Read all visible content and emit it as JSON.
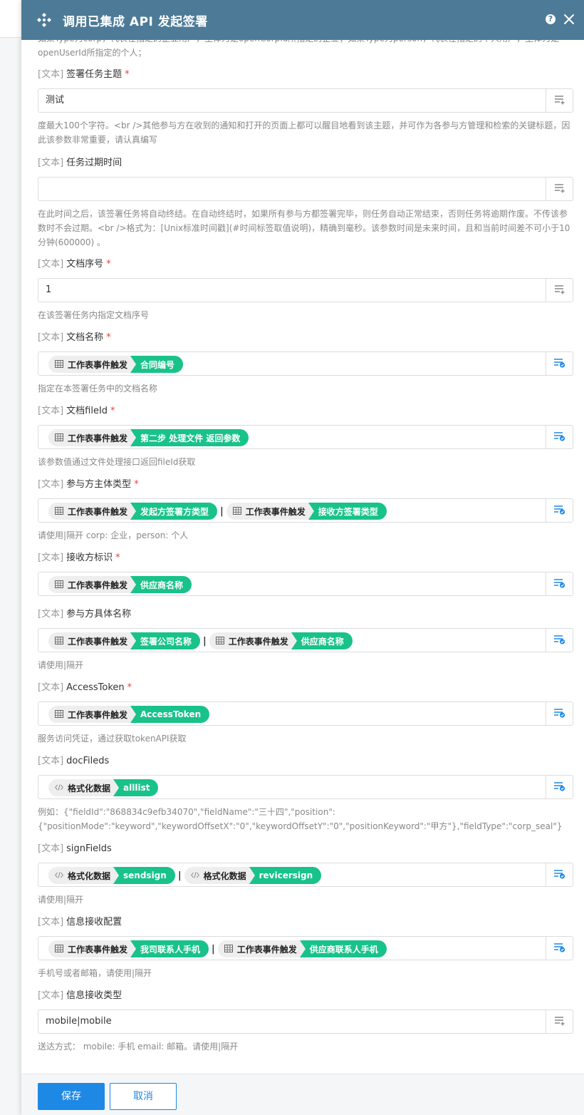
{
  "dialog": {
    "title": "调用已集成 API 发起签署",
    "help_label": "?"
  },
  "top_desc": "如果Type为corp，代表在指定的企业用户，主体为是openCorpId所指定的企业；如果Type为person，代表在指定的个人用户，主体为是openUserId所指定的个人；",
  "fields": [
    {
      "tag": "[文本]",
      "label": "签署任务主题",
      "required": "*",
      "value": "测试",
      "desc": "度最大100个字符。<br />其他参与方在收到的通知和打开的页面上都可以醒目地看到该主题，并可作为各参与方管理和检索的关键标题，因此该参数非常重要，请认真编写"
    },
    {
      "tag": "[文本]",
      "label": "任务过期时间",
      "value": "",
      "desc": "在此时间之后，该签署任务将自动终结。在自动终结时，如果所有参与方都签署完毕，则任务自动正常结束，否则任务将逾期作废。不传该参数时不会过期。<br />格式为：[Unix标准时间戳](#时间标签取值说明)，精确到毫秒。该参数时间是未来时间，且和当前时间差不可小于10分钟(600000) 。"
    },
    {
      "tag": "[文本]",
      "label": "文档序号",
      "required": "*",
      "value": "1",
      "desc": "在该签署任务内指定文档序号"
    },
    {
      "tag": "[文本]",
      "label": "文档名称",
      "required": "*",
      "chips": [
        {
          "source": "工作表事件触发",
          "value": "合同编号"
        }
      ],
      "desc": "指定在本签署任务中的文档名称"
    },
    {
      "tag": "[文本]",
      "label": "文档fileId",
      "required": "*",
      "chips": [
        {
          "source": "工作表事件触发",
          "value": "第二步 处理文件 返回参数"
        }
      ],
      "desc": "该参数值通过文件处理接口返回fileId获取"
    },
    {
      "tag": "[文本]",
      "label": "参与方主体类型",
      "required": "*",
      "chips": [
        {
          "source": "工作表事件触发",
          "value": "发起方签署方类型"
        },
        {
          "source": "工作表事件触发",
          "value": "接收方签署类型"
        }
      ],
      "separator": "|",
      "desc": "请使用|隔开 corp: 企业，person: 个人"
    },
    {
      "tag": "[文本]",
      "label": "接收方标识",
      "required": "*",
      "chips": [
        {
          "source": "工作表事件触发",
          "value": "供应商名称"
        }
      ]
    },
    {
      "tag": "[文本]",
      "label": "参与方具体名称",
      "chips": [
        {
          "source": "工作表事件触发",
          "value": "签署公司名称"
        },
        {
          "source": "工作表事件触发",
          "value": "供应商名称"
        }
      ],
      "separator": "|",
      "desc": "请使用|隔开"
    },
    {
      "tag": "[文本]",
      "label": "AccessToken",
      "required": "*",
      "chips": [
        {
          "source": "工作表事件触发",
          "value": "AccessToken"
        }
      ],
      "desc": "服务访问凭证，通过获取tokenAPI获取"
    },
    {
      "tag": "[文本]",
      "label": "docFileds",
      "chips": [
        {
          "source": "格式化数据",
          "value": "alllist"
        }
      ],
      "desc": "例如：{\"fieldId\":\"868834c9efb34070\",\"fieldName\":\"三十四\",\"position\":{\"positionMode\":\"keyword\",\"keywordOffsetX\":\"0\",\"keywordOffsetY\":\"0\",\"positionKeyword\":\"甲方\"},\"fieldType\":\"corp_seal\"}"
    },
    {
      "tag": "[文本]",
      "label": "signFields",
      "chips": [
        {
          "source": "格式化数据",
          "value": "sendsign"
        },
        {
          "source": "格式化数据",
          "value": "revicersign"
        }
      ],
      "separator": "|",
      "desc": "请使用|隔开"
    },
    {
      "tag": "[文本]",
      "label": "信息接收配置",
      "chips": [
        {
          "source": "工作表事件触发",
          "value": "我司联系人手机"
        },
        {
          "source": "工作表事件触发",
          "value": "供应商联系人手机"
        }
      ],
      "separator": "|",
      "desc": "手机号或者邮箱，请使用|隔开"
    },
    {
      "tag": "[文本]",
      "label": "信息接收类型",
      "value": "mobile|mobile",
      "desc": "送达方式： mobile: 手机 email: 邮箱。请使用|隔开"
    }
  ],
  "footer": {
    "save_label": "保存",
    "cancel_label": "取消"
  },
  "colors": {
    "header": "#4d7a97",
    "chip_value": "#19c28a",
    "primary": "#1e88e5",
    "required": "#e64343"
  }
}
